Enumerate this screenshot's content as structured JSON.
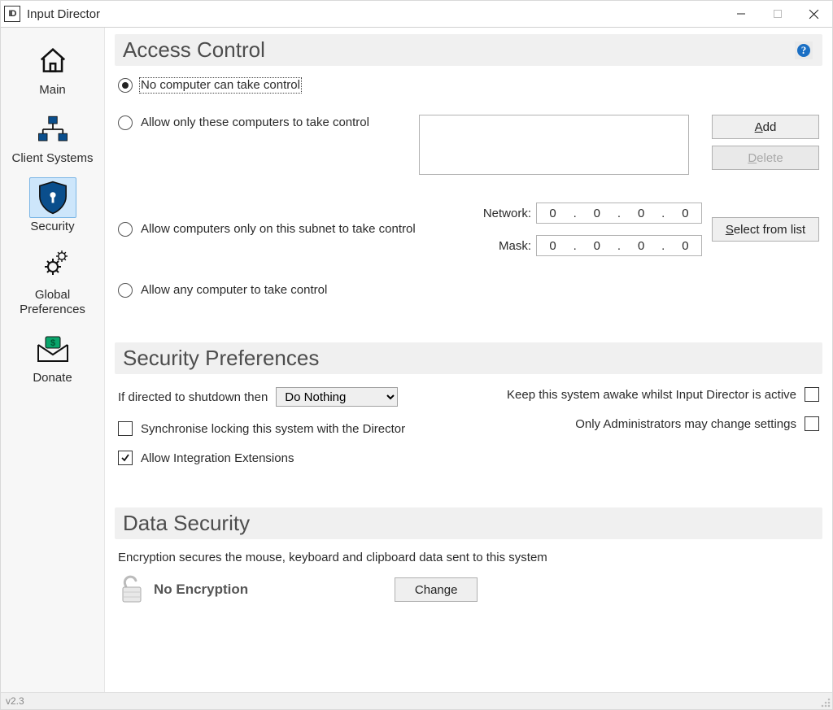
{
  "window": {
    "title": "Input Director"
  },
  "sidebar": {
    "items": [
      {
        "label": "Main"
      },
      {
        "label": "Client Systems"
      },
      {
        "label": "Security"
      },
      {
        "label": "Global Preferences"
      },
      {
        "label": "Donate"
      }
    ],
    "selected_index": 2
  },
  "access_control": {
    "heading": "Access Control",
    "radio_none": "No computer can take control",
    "radio_allowed_list": "Allow only these computers to take control",
    "radio_subnet": "Allow computers only on this subnet to take control",
    "radio_any": "Allow any computer to take control",
    "selected": "none",
    "buttons": {
      "add": "Add",
      "delete": "Delete",
      "select_from_list": "Select from list"
    },
    "network_label": "Network:",
    "mask_label": "Mask:",
    "network": [
      "0",
      "0",
      "0",
      "0"
    ],
    "mask": [
      "0",
      "0",
      "0",
      "0"
    ]
  },
  "security_prefs": {
    "heading": "Security Preferences",
    "shutdown_label": "If directed to shutdown then",
    "shutdown_value": "Do Nothing",
    "shutdown_options": [
      "Do Nothing"
    ],
    "sync_lock": "Synchronise locking this system with the Director",
    "allow_ext": "Allow Integration Extensions",
    "keep_awake": "Keep this system awake whilst Input Director is active",
    "admin_only": "Only Administrators may change settings",
    "sync_lock_checked": false,
    "allow_ext_checked": true,
    "keep_awake_checked": false,
    "admin_only_checked": false
  },
  "data_security": {
    "heading": "Data Security",
    "description": "Encryption secures the mouse, keyboard and clipboard data sent to this system",
    "state": "No Encryption",
    "change": "Change"
  },
  "statusbar": {
    "version": "v2.3"
  }
}
